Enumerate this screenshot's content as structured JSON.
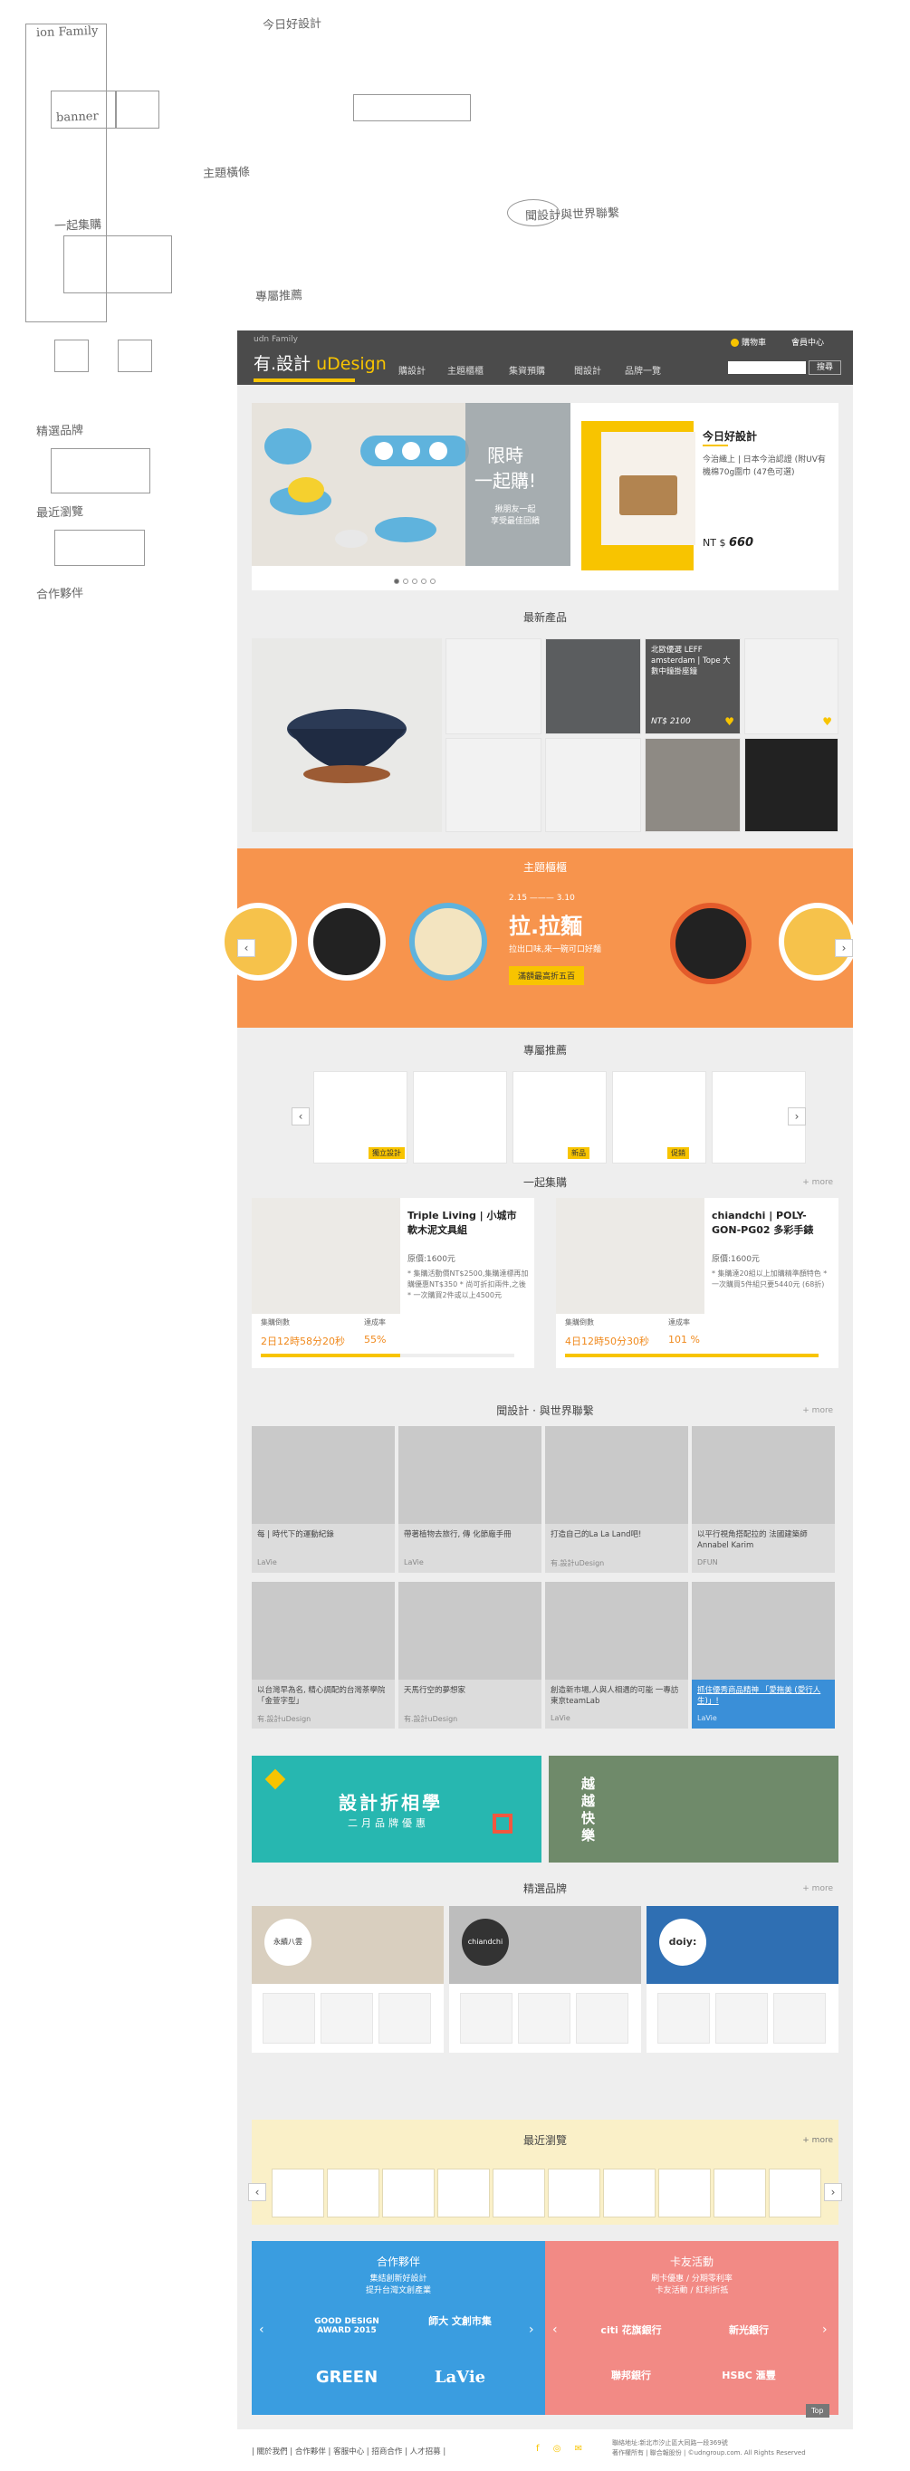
{
  "sketch": {
    "notes_top": [
      "ion Family",
      "banner",
      "今日好設計",
      "主題橫條",
      "專屬推薦",
      "一起集購",
      "聞設計與世界聯繫",
      "精選品牌",
      "最近瀏覽",
      "合作夥伴"
    ]
  },
  "header": {
    "family": "udn Family",
    "logo_prefix": "有.設計",
    "logo_brand": "uDesign",
    "nav": [
      "購設計",
      "主題櫃櫃",
      "集資預購",
      "聞設計",
      "品牌一覽"
    ],
    "cart": "購物車",
    "member": "會員中心",
    "search_button": "搜尋"
  },
  "banner": {
    "headline1": "限時",
    "headline2": "一起購!",
    "sub1": "揪朋友一起",
    "sub2": "享受最佳回饋"
  },
  "daily": {
    "title": "今日好設計",
    "desc": "今治織上 | 日本今治認證 (附UV有機棉70g圍巾 (47色可選)",
    "price_prefix": "NT $",
    "price": "660"
  },
  "new_products": {
    "title": "最新產品",
    "featured_text": "北歐優選 LEFF amsterdam | Tope 大數中鐘掛座鐘",
    "featured_price": "NT$ 2100"
  },
  "theme": {
    "title": "主題櫃櫃",
    "date_from": "2.15",
    "date_to": "3.10",
    "headline": "拉.拉麵",
    "sub": "拉出口味,來一碗可口好麵",
    "cta": "滿額最高折五百"
  },
  "recommend": {
    "title": "專屬推薦",
    "tags": [
      "獨立設計",
      "新品",
      "促銷"
    ]
  },
  "group_buy": {
    "title": "一起集購",
    "more": "+ more",
    "items": [
      {
        "title": "Triple Living | 小城市軟木泥文具組",
        "price": "原價:1600元",
        "bullets": "* 集購活動價NT$2500,集購達標再加購優惠NT$350 * 尚可折扣兩件,之後 * 一次購買2件或以上4500元",
        "count_label": "集購倒數",
        "rate_label": "達成率",
        "countdown": "2日12時58分20秒",
        "rate": "55%",
        "progress": 0.55
      },
      {
        "title": "chiandchi | POLY-GON-PG02 多彩手錶",
        "price": "原價:1600元",
        "bullets": "* 集購達20組以上加購精準顏特色 * 一次購買5件組只要5440元 (68折)",
        "count_label": "集購倒數",
        "rate_label": "達成率",
        "countdown": "4日12時50分30秒",
        "rate": "101 %",
        "progress": 1.0
      }
    ]
  },
  "articles": {
    "title": "聞設計 · 與世界聯繫",
    "more": "+ more",
    "items": [
      {
        "caption": "每 | 時代下的運動紀錄",
        "source": "LaVie"
      },
      {
        "caption": "帶著植物去旅行, 傳 化節廠手冊",
        "source": "LaVie"
      },
      {
        "caption": "打造自己的La La Land吧!",
        "source": "有.設計uDesign"
      },
      {
        "caption": "以平行視角搭配拉的 法國建築師Annabel Karim",
        "source": "DFUN"
      },
      {
        "caption": "以台灣早為名, 精心調配的台灣茶學院「金萱字型」",
        "source": "有.設計uDesign"
      },
      {
        "caption": "天馬行空的夢想家",
        "source": "有.設計uDesign"
      },
      {
        "caption": "創造新市場,人與人相遇的可能 一專訪東京teamLab",
        "source": "LaVie"
      },
      {
        "caption": "抓住優秀商品精神 「愛拖美 (愛行人生)」!",
        "source": "LaVie"
      }
    ]
  },
  "promos": {
    "left_title": "設計折相學",
    "left_sub": "二月品牌優惠",
    "right_text": "越 越 快 樂"
  },
  "brands": {
    "title": "精選品牌",
    "more": "+ more",
    "items": [
      "永續八雲",
      "chiandchi",
      "doiy:"
    ]
  },
  "recent": {
    "title": "最近瀏覽",
    "more": "+ more"
  },
  "partners": {
    "title": "合作夥伴",
    "sub1": "集結創新好設計",
    "sub2": "提升台灣文創產業",
    "logos": [
      "GOOD DESIGN AWARD 2015",
      "師大 文創市集",
      "GREEN",
      "LaVie"
    ]
  },
  "card_activity": {
    "title": "卡友活動",
    "sub1": "刷卡優惠 / 分期零利率",
    "sub2": "卡友活動 / 紅利折抵",
    "logos": [
      "citi 花旗銀行",
      "新光銀行",
      "聯邦銀行",
      "HSBC 滙豐"
    ]
  },
  "footer": {
    "links": "| 關於我們 | 合作夥伴 | 客服中心 | 招商合作 | 人才招募 |",
    "right1": "聯絡地址:新北市汐止區大同路一段369號",
    "right2": "著作權所有 | 聯合報股份 | ©udngroup.com. All Rights Reserved",
    "top": "Top"
  },
  "colors": {
    "accent": "#f8c400",
    "header_bg": "#4b4b4b",
    "theme_orange": "#f7944d",
    "partner_blue": "#3a9de0",
    "card_pink": "#f28a85"
  }
}
